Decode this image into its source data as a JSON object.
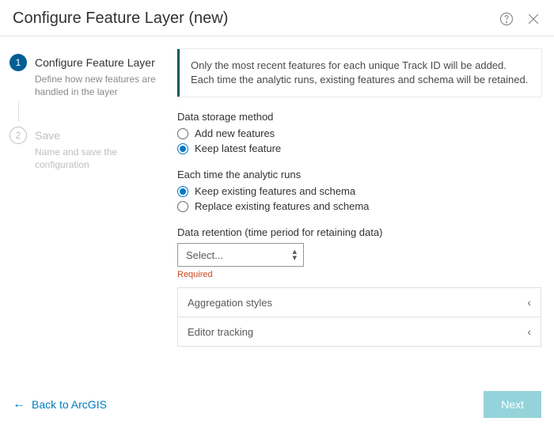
{
  "header": {
    "title": "Configure Feature Layer (new)"
  },
  "sidebar": {
    "steps": [
      {
        "num": "1",
        "title": "Configure Feature Layer",
        "desc": "Define how new features are handled in the layer"
      },
      {
        "num": "2",
        "title": "Save",
        "desc": "Name and save the configuration"
      }
    ]
  },
  "main": {
    "info": "Only the most recent features for each unique Track ID will be added. Each time the analytic runs, existing features and schema will be retained.",
    "storage": {
      "label": "Data storage method",
      "options": [
        "Add new features",
        "Keep latest feature"
      ],
      "selected": 1
    },
    "runs": {
      "label": "Each time the analytic runs",
      "options": [
        "Keep existing features and schema",
        "Replace existing features and schema"
      ],
      "selected": 0
    },
    "retention": {
      "label": "Data retention (time period for retaining data)",
      "placeholder": "Select...",
      "required": "Required"
    },
    "accordion": [
      "Aggregation styles",
      "Editor tracking"
    ]
  },
  "footer": {
    "back": "Back to ArcGIS",
    "next": "Next"
  }
}
